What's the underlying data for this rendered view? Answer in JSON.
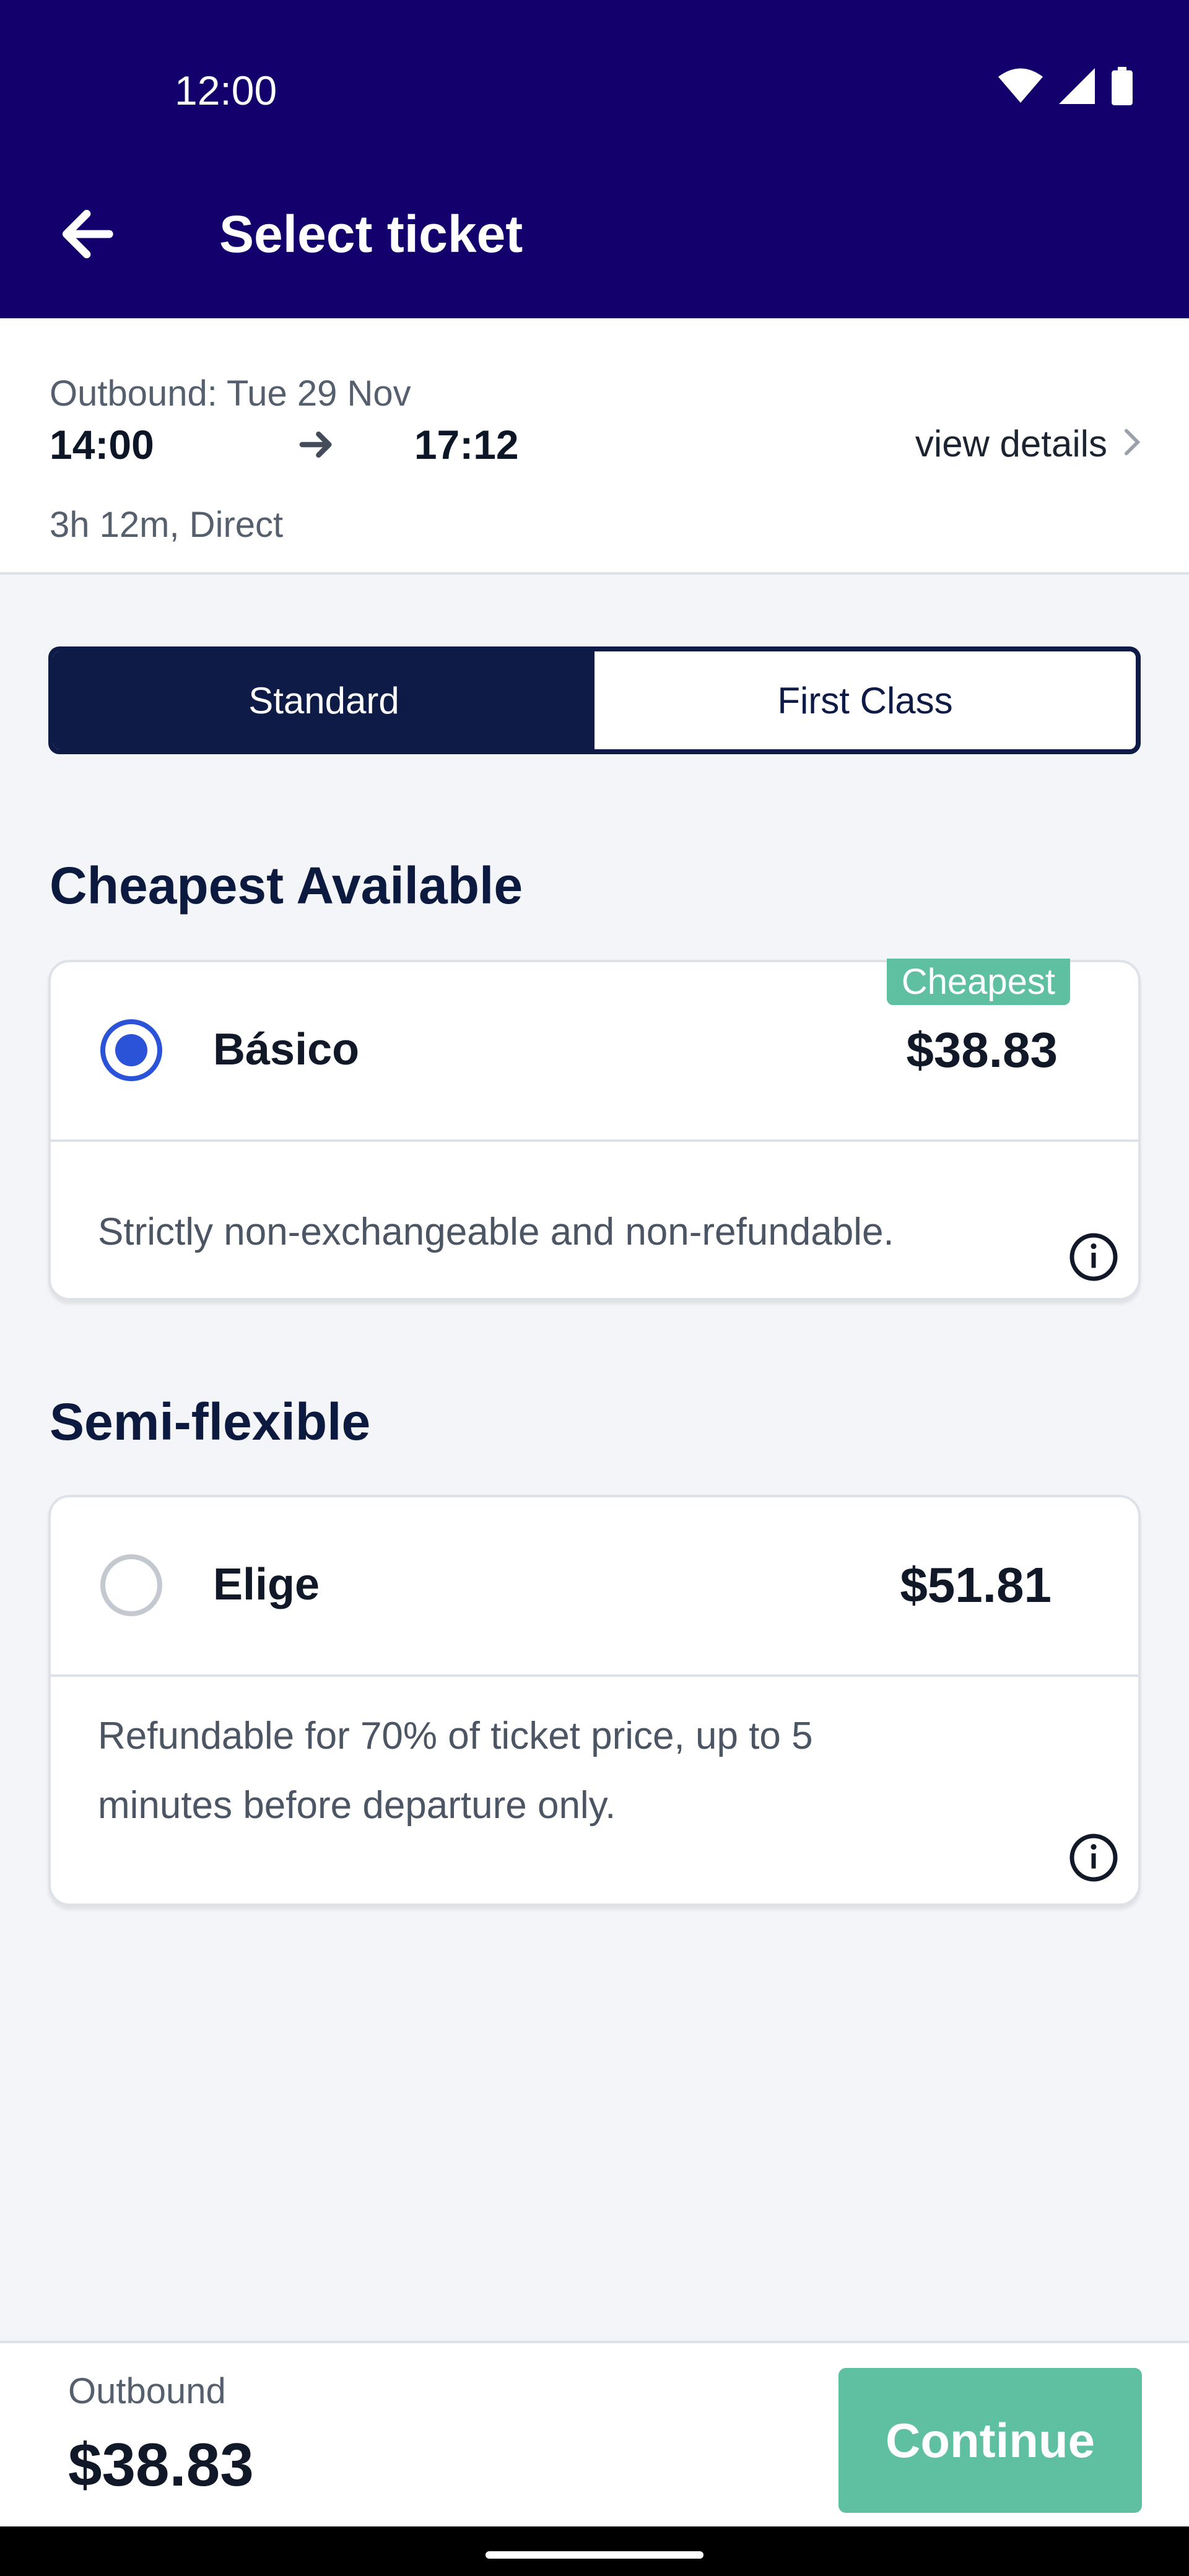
{
  "status_bar": {
    "time": "12:00",
    "icons": [
      "wifi-icon",
      "signal-icon",
      "battery-icon"
    ]
  },
  "header": {
    "title": "Select ticket",
    "back_icon": "arrow-left-icon"
  },
  "journey": {
    "date": "Outbound: Tue 29 Nov",
    "depart": "14:00",
    "arrive": "17:12",
    "duration": "3h 12m, Direct",
    "view_details": "view details"
  },
  "class_toggle": {
    "options": [
      "Standard",
      "First Class"
    ],
    "selected": "Standard"
  },
  "sections": [
    {
      "title": "Cheapest Available",
      "fare": {
        "name": "Básico",
        "price": "$38.83",
        "badge": "Cheapest",
        "selected": true,
        "description": "Strictly non-exchangeable and non-refundable."
      }
    },
    {
      "title": "Semi-flexible",
      "fare": {
        "name": "Elige",
        "price": "$51.81",
        "selected": false,
        "description": "Refundable for 70% of ticket price, up to 5 minutes before departure only."
      }
    }
  ],
  "footer": {
    "label": "Outbound",
    "price": "$38.83",
    "continue_label": "Continue"
  },
  "colors": {
    "header_bg": "#14006d",
    "navy": "#0e1b46",
    "accent_green": "#5ebfa1",
    "radio_blue": "#2a53d8"
  }
}
